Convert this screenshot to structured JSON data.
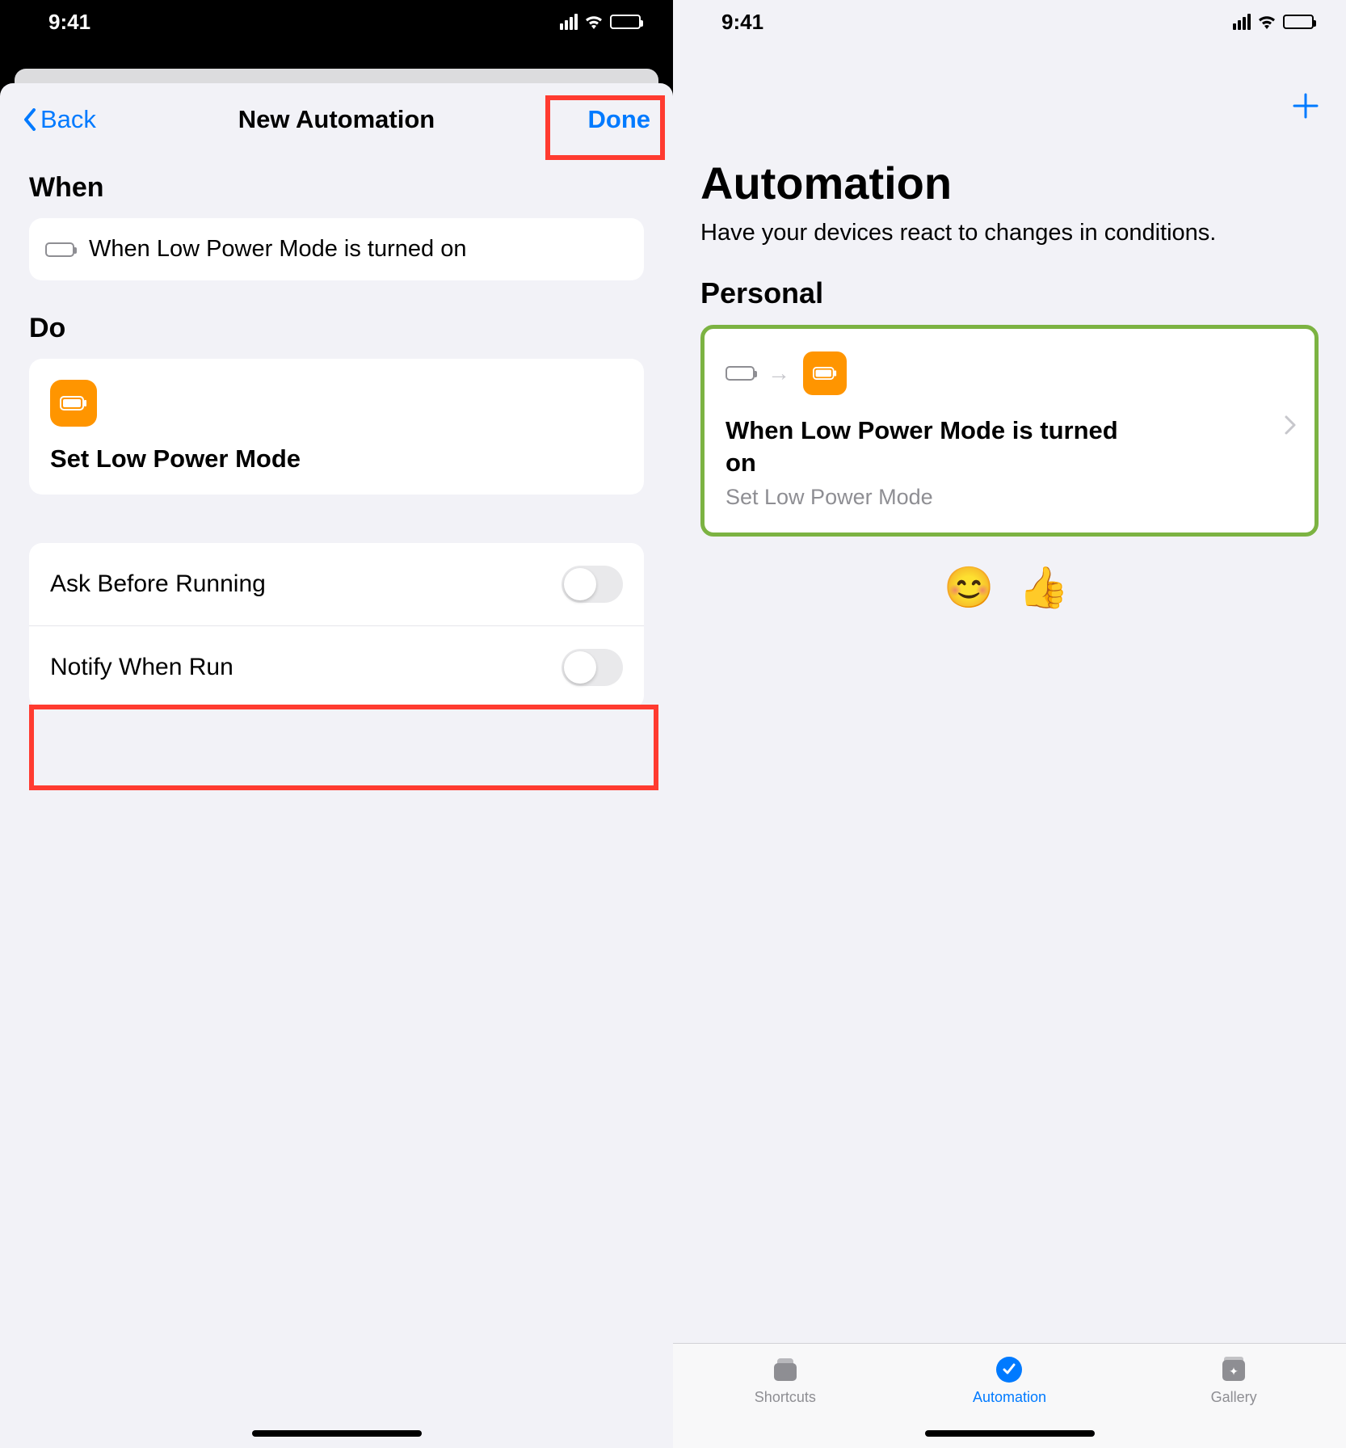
{
  "status": {
    "time": "9:41"
  },
  "left": {
    "nav": {
      "back": "Back",
      "title": "New Automation",
      "done": "Done"
    },
    "when": {
      "header": "When",
      "trigger": "When Low Power Mode is turned on"
    },
    "do": {
      "header": "Do",
      "action": "Set Low Power Mode"
    },
    "options": {
      "ask": "Ask Before Running",
      "notify": "Notify When Run"
    }
  },
  "right": {
    "title": "Automation",
    "subtitle": "Have your devices react to changes in conditions.",
    "personal": "Personal",
    "automation": {
      "title": "When Low Power Mode is turned on",
      "sub": "Set Low Power Mode"
    },
    "emojis": "😊 👍",
    "tabs": {
      "shortcuts": "Shortcuts",
      "automation": "Automation",
      "gallery": "Gallery"
    }
  }
}
